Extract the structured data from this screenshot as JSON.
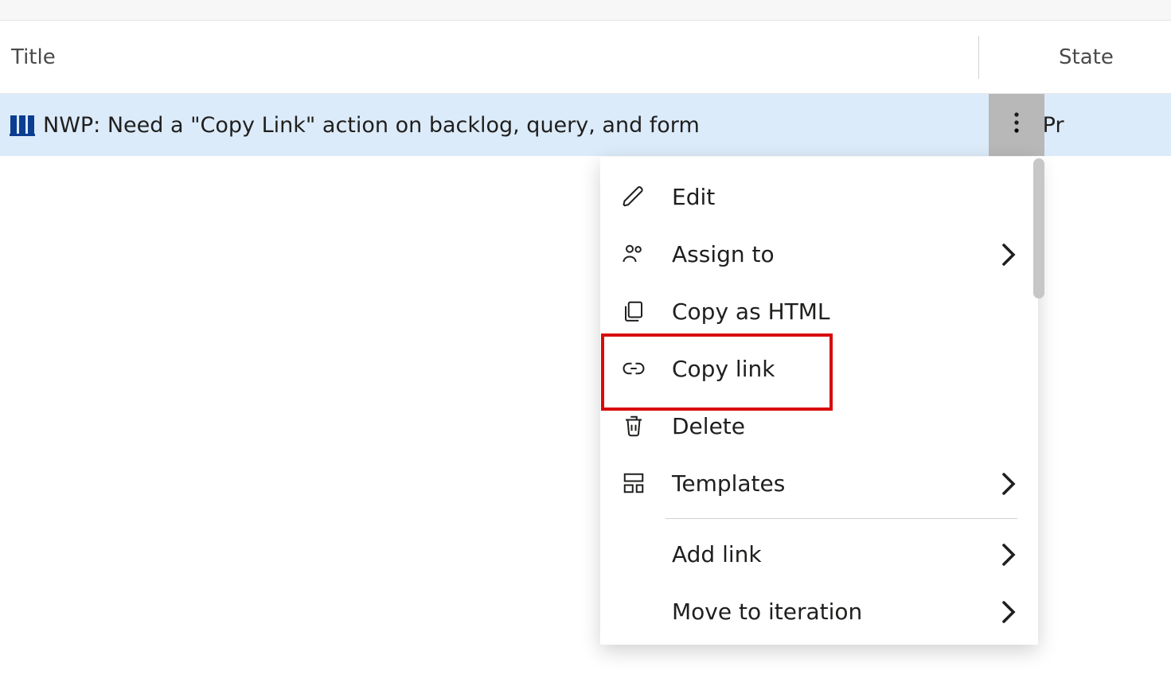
{
  "columns": {
    "title": "Title",
    "state": "State"
  },
  "row": {
    "title": "NWP: Need a \"Copy Link\" action on backlog, query, and form",
    "state": "In Pr",
    "state_color": "#0078d4"
  },
  "menu": {
    "items": [
      {
        "id": "edit",
        "label": "Edit",
        "icon": "pencil",
        "submenu": false
      },
      {
        "id": "assign_to",
        "label": "Assign to",
        "icon": "people",
        "submenu": true
      },
      {
        "id": "copy_as_html",
        "label": "Copy as HTML",
        "icon": "copy",
        "submenu": false
      },
      {
        "id": "copy_link",
        "label": "Copy link",
        "icon": "link",
        "submenu": false
      },
      {
        "id": "delete",
        "label": "Delete",
        "icon": "trash",
        "submenu": false
      },
      {
        "id": "templates",
        "label": "Templates",
        "icon": "template",
        "submenu": true
      }
    ],
    "items_after_divider": [
      {
        "id": "add_link",
        "label": "Add link",
        "icon": "",
        "submenu": true
      },
      {
        "id": "move_to_iteration",
        "label": "Move to iteration",
        "icon": "",
        "submenu": true
      }
    ]
  },
  "highlighted_menu_item": "copy_link"
}
